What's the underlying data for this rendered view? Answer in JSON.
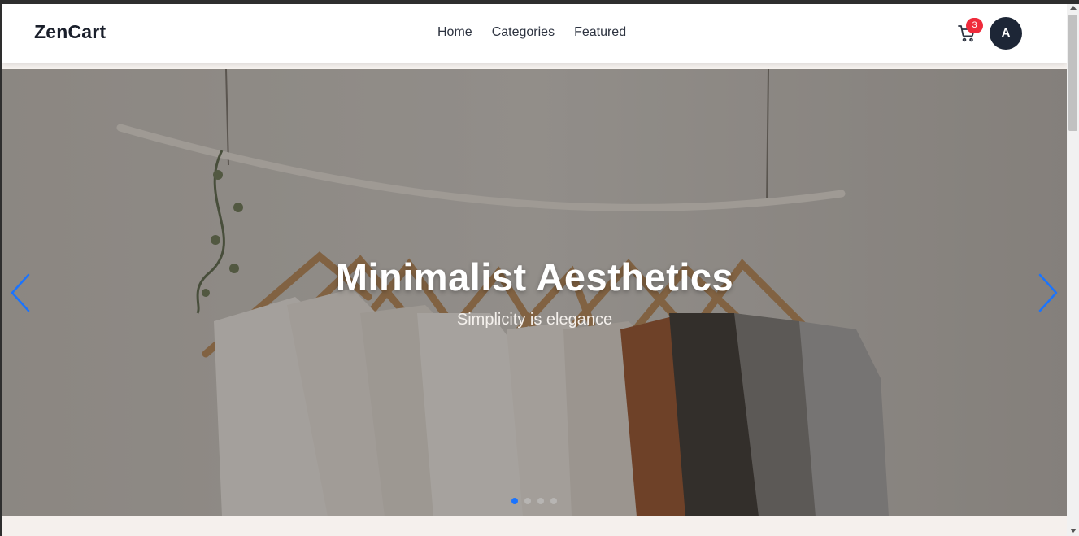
{
  "header": {
    "brand": "ZenCart",
    "nav": [
      "Home",
      "Categories",
      "Featured"
    ],
    "cart_count": "3",
    "avatar_initial": "A"
  },
  "hero": {
    "title": "Minimalist Aesthetics",
    "subtitle": "Simplicity is elegance",
    "slide_count": 4,
    "active_slide": 1
  },
  "colors": {
    "accent": "#1a74ff",
    "badge": "#ef2b3b",
    "avatar_bg": "#1d2636",
    "brand_text": "#1a1f2b"
  },
  "icons": [
    "cart-icon",
    "chevron-left-icon",
    "chevron-right-icon"
  ]
}
